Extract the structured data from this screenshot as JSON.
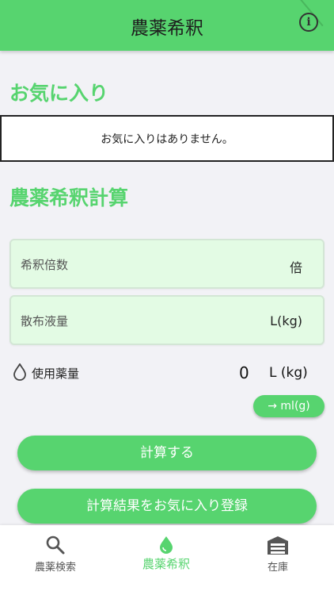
{
  "header": {
    "title": "農薬希釈",
    "info_icon": "info-icon"
  },
  "favorites": {
    "title": "お気に入り",
    "empty_message": "お気に入りはありません。"
  },
  "calculator": {
    "title": "農薬希釈計算",
    "dilution_ratio": {
      "label": "希釈倍数",
      "unit": "倍",
      "value": ""
    },
    "spray_volume": {
      "label": "散布液量",
      "unit": "L(kg)",
      "value": ""
    },
    "usage": {
      "label": "使用薬量",
      "value": "0",
      "unit": "L (kg)",
      "icon": "drop-icon"
    },
    "convert_button": "→ ml(g)",
    "calc_button": "計算する",
    "save_favorite_button": "計算結果をお気に入り登録"
  },
  "tabbar": {
    "active": "農薬希釈",
    "items": [
      {
        "label": "農薬検索",
        "icon": "search-icon"
      },
      {
        "label": "農薬希釈",
        "icon": "drop-icon"
      },
      {
        "label": "在庫",
        "icon": "warehouse-icon"
      }
    ]
  },
  "colors": {
    "accent": "#57d46f",
    "field_bg": "#e3fbe4",
    "background": "#f2f2f6"
  }
}
